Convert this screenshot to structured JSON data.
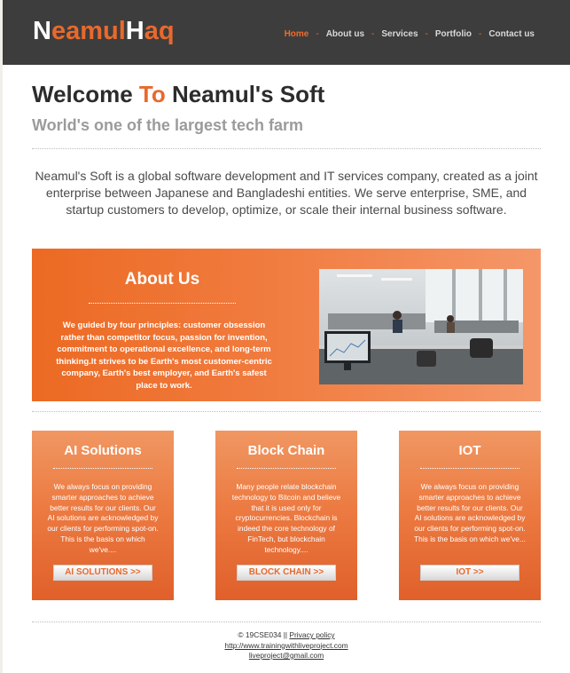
{
  "logo": {
    "part1": "N",
    "part2": "eamul",
    "part3": "H",
    "part4": "aq"
  },
  "nav": {
    "items": [
      "Home",
      "About us",
      "Services",
      "Portfolio",
      "Contact us"
    ],
    "separator": "-"
  },
  "hero": {
    "title_part1": "Welcome",
    "title_accent": "To",
    "title_part2": "Neamul's Soft",
    "tagline": "World's one of the largest tech farm",
    "intro": "Neamul's Soft is a global software development and IT services company, created as a joint enterprise between Japanese and Bangladeshi entities. We serve enterprise, SME, and startup customers to develop, optimize, or scale their internal business software."
  },
  "about": {
    "title": "About Us",
    "text": "We guided by four principles: customer obsession rather than competitor focus, passion for invention, commitment to operational excellence, and long-term thinking.It strives to be Earth's most customer-centric company, Earth's best employer, and Earth's safest place to work."
  },
  "cards": [
    {
      "title": "AI Solutions",
      "text": "We always focus on providing smarter approaches to achieve better results for our clients. Our AI solutions are acknowledged by our clients for performing spot-on. This is the basis on which we've....",
      "button": "AI SOLUTIONS >>"
    },
    {
      "title": "Block Chain",
      "text": "Many people relate blockchain technology to Bitcoin and believe that it is used only for cryptocurrencies. Blockchain is indeed the core technology of FinTech, but blockchain technology....",
      "button": "BLOCK CHAIN >>"
    },
    {
      "title": "IOT",
      "text": "We always focus on providing smarter approaches to achieve better results for our clients. Our AI solutions are acknowledged by our clients for performing spot-on. This is the basis on which we've...",
      "button": "IOT >>"
    }
  ],
  "footer": {
    "copyright": "© 19CSE034 ||",
    "privacy": "Privacy policy",
    "website": "http://www.trainingwithliveproject.com",
    "email": "liveproject@gmail.com"
  },
  "colors": {
    "accent": "#e8692d",
    "header_bg": "#3d3d3d",
    "nav_text": "#d9d9d9"
  }
}
